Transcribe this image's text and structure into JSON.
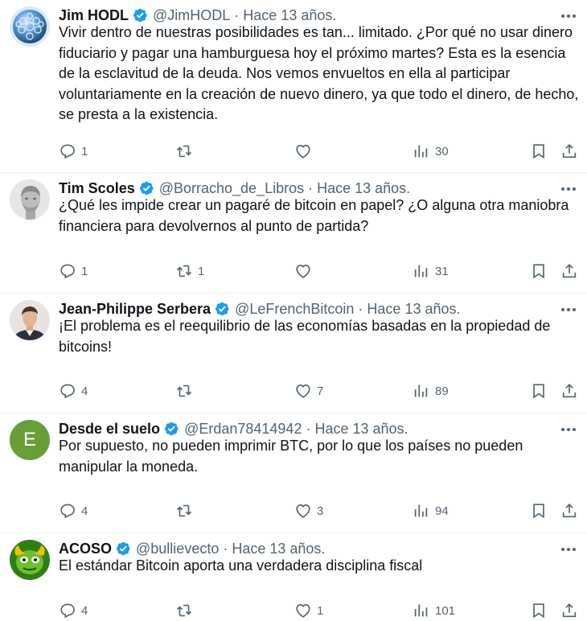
{
  "tweets": [
    {
      "name": "Jim HODL",
      "handle": "@JimHODL",
      "separator": "·",
      "time": "Hace 13 años.",
      "text": "Vivir dentro de nuestras posibilidades es tan... limitado. ¿Por qué no usar dinero fiduciario y pagar una hamburguesa hoy el próximo martes? Esta es la esencia de la esclavitud de la deuda. Nos vemos envueltos en ella al participar voluntariamente en la creación de nuevo dinero, ya que todo el dinero, de hecho, se presta a la existencia.",
      "replies": "1",
      "retweets": "",
      "likes": "",
      "views": "30",
      "avatar": "blue-sphere-avatar"
    },
    {
      "name": "Tim Scoles",
      "handle": "@Borracho_de_Libros",
      "separator": "·",
      "time": "Hace 13 años.",
      "text": "¿Qué les impide crear un pagaré de bitcoin en papel? ¿O alguna otra maniobra financiera para devolvernos al punto de partida?",
      "replies": "1",
      "retweets": "1",
      "likes": "",
      "views": "31",
      "avatar": "statue-avatar"
    },
    {
      "name": "Jean-Philippe Serbera",
      "handle": "@LeFrenchBitcoin",
      "separator": "·",
      "time": "Hace 13 años.",
      "text": "¡El problema es el reequilibrio de las economías basadas en la propiedad de bitcoins!",
      "replies": "4",
      "retweets": "",
      "likes": "7",
      "views": "89",
      "avatar": "portrait-avatar"
    },
    {
      "name": "Desde el suelo",
      "handle": "@Erdan78414942",
      "separator": "·",
      "time": "Hace 13 años.",
      "text": "Por supuesto, no pueden imprimir BTC, por lo que los países no pueden manipular la moneda.",
      "replies": "4",
      "retweets": "",
      "likes": "3",
      "views": "94",
      "avatar": "letter-avatar",
      "avatar_letter": "E",
      "avatar_color": "#689f38"
    },
    {
      "name": "ACOSO",
      "handle": "@bullievecto",
      "separator": "·",
      "time": "Hace 13 años.",
      "text": "El estándar Bitcoin aporta una verdadera disciplina fiscal",
      "replies": "4",
      "retweets": "",
      "likes": "1",
      "views": "101",
      "avatar": "green-creature-avatar"
    }
  ],
  "colors": {
    "verified": "#1d9bf0",
    "text": "#0f1419",
    "secondary": "#536471",
    "divider": "#eff3f4"
  },
  "icons": [
    "verified-badge-icon",
    "more-icon",
    "reply-icon",
    "retweet-icon",
    "like-icon",
    "views-icon",
    "bookmark-icon",
    "share-icon"
  ]
}
